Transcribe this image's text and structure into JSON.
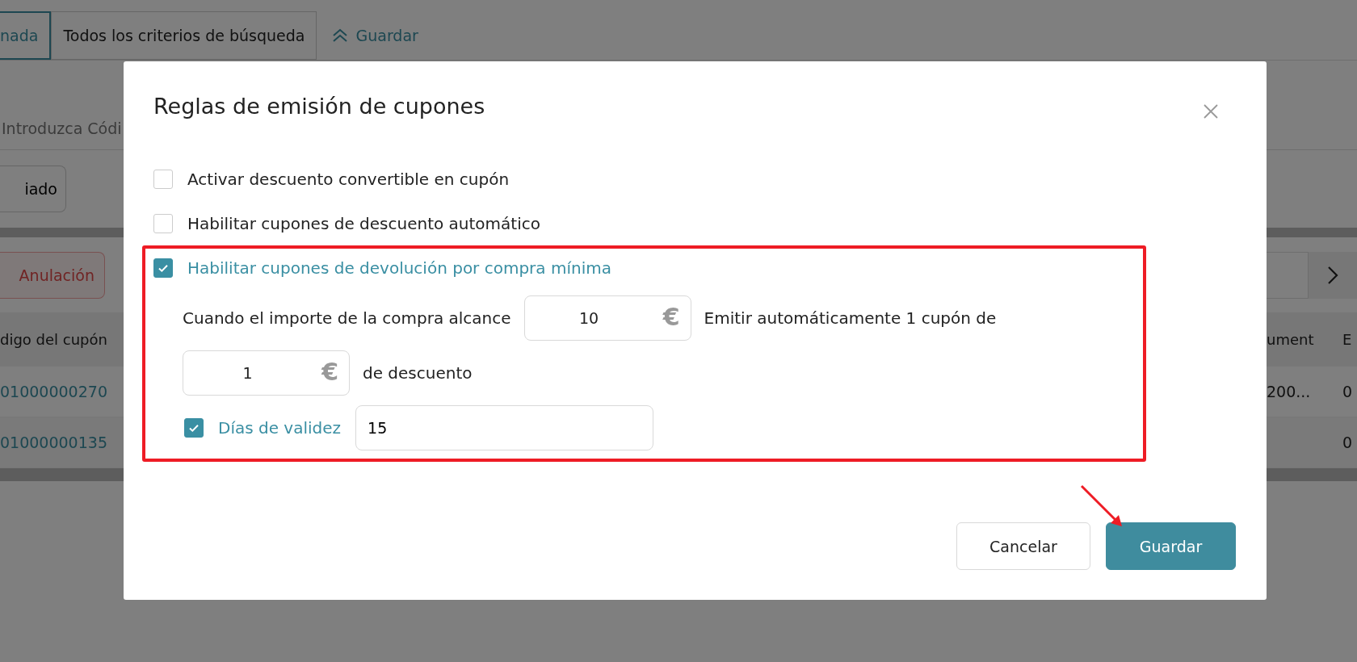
{
  "background": {
    "tabs": [
      {
        "label": "nada",
        "selected": true
      },
      {
        "label": "Todos los criterios de búsqueda",
        "selected": false
      }
    ],
    "save_link": "Guardar",
    "search": {
      "placeholder": "Introduzca Códi"
    },
    "filter_button": "iado",
    "void_button": "Anulación",
    "table": {
      "columns": [
        "digo del cupón",
        "ument",
        "E"
      ],
      "rows": [
        [
          "01000000270",
          "200...",
          "0"
        ],
        [
          "01000000135",
          null,
          "0"
        ]
      ]
    }
  },
  "dialog": {
    "title": "Reglas de emisión de cupones",
    "options": [
      {
        "label": "Activar descuento convertible en cupón",
        "checked": false
      },
      {
        "label": "Habilitar cupones de descuento automático",
        "checked": false
      },
      {
        "label": "Habilitar cupones de devolución por compra mínima",
        "checked": true
      }
    ],
    "rule": {
      "text_before": "Cuando el importe de la compra alcance",
      "amount": "10",
      "amount_currency": "€",
      "text_middle": "Emitir automáticamente 1 cupón de",
      "discount": "1",
      "discount_currency": "€",
      "text_after": "de descuento",
      "validity": {
        "label": "Días de validez",
        "checked": true,
        "value": "15"
      }
    },
    "buttons": [
      {
        "label": "Cancelar",
        "kind": "secondary"
      },
      {
        "label": "Guardar",
        "kind": "primary"
      }
    ]
  }
}
